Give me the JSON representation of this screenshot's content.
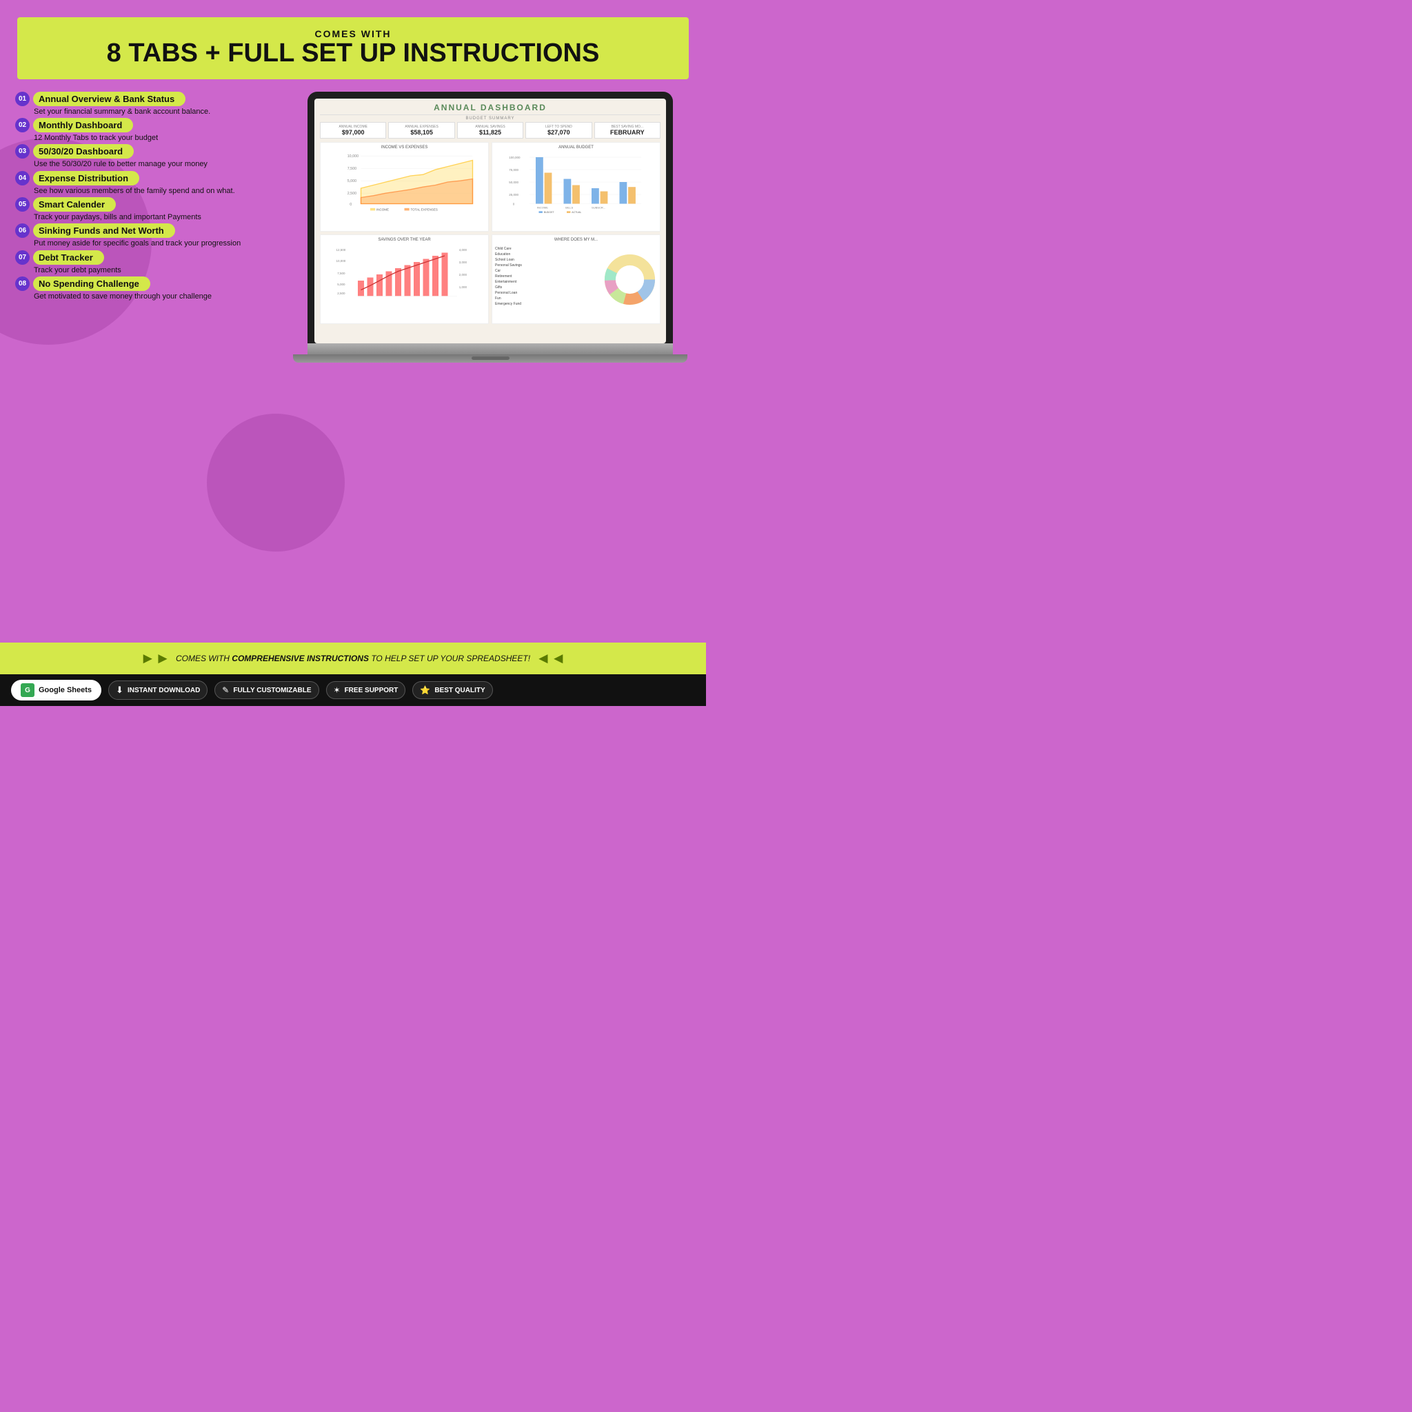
{
  "header": {
    "sub_label": "COMES WITH",
    "main_label": "8 TABS + FULL SET UP INSTRUCTIONS"
  },
  "features": [
    {
      "number": "01",
      "title": "Annual Overview & Bank Status",
      "label_text": "Annual Overview & Bank Status",
      "description": "Set your financial summary & bank account balance."
    },
    {
      "number": "02",
      "title": "Monthly Dashboard",
      "label_text": "Monthly Dashboard",
      "description": "12 Monthly Tabs to track your budget"
    },
    {
      "number": "03",
      "title": "50/30/20 Dashboard",
      "label_text": "50/30/20 Dashboard",
      "description": "Use the 50/30/20 rule to better manage your money"
    },
    {
      "number": "04",
      "title": "Expense Distribution",
      "label_text": "Expense Distribution",
      "description": "See how various members of the family spend and on what."
    },
    {
      "number": "05",
      "title": "Smart Calender",
      "label_text": "Smart Calender",
      "description": "Track your paydays, bills and important Payments"
    },
    {
      "number": "06",
      "title": "Sinking Funds and Net Worth",
      "label_text": "Sinking Funds and Net Worth",
      "description": "Put money aside for specific goals and track your progression"
    },
    {
      "number": "07",
      "title": "Debt Tracker",
      "label_text": "Debt Tracker",
      "description": "Track your debt payments"
    },
    {
      "number": "08",
      "title": "No Spending Challenge",
      "label_text": "No Spending Challenge",
      "description": "Get motivated to save money through your challenge"
    }
  ],
  "dashboard": {
    "title": "ANNUAL DASHBOARD",
    "budget_summary_label": "BUDGET SUMMARY",
    "cards": [
      {
        "label": "ANNUAL INCOME",
        "value": "$97,000"
      },
      {
        "label": "ANNUAL EXPENSES",
        "value": "$58,105"
      },
      {
        "label": "ANNUAL SAVINGS",
        "value": "$11,825"
      },
      {
        "label": "LEFT TO SPEND",
        "value": "$27,070"
      },
      {
        "label": "BEST SAVING MO...",
        "value": "FEBRUARY"
      }
    ],
    "charts": [
      {
        "title": "INCOME vs EXPENSES"
      },
      {
        "title": "ANNUAL BUDGET"
      },
      {
        "title": "SAVINGS OVER THE YEAR"
      },
      {
        "title": "WHERE DOES MY M..."
      }
    ]
  },
  "footer": {
    "text_plain": "COMES WITH ",
    "text_bold": "COMPREHENSIVE INSTRUCTIONS",
    "text_after": " TO HELP SET UP YOUR SPREADSHEET!"
  },
  "bottom_bar": {
    "badges": [
      {
        "type": "google",
        "label": "Google Sheets"
      },
      {
        "type": "dark",
        "icon": "download",
        "label": "INSTANT DOWNLOAD"
      },
      {
        "type": "dark",
        "icon": "edit",
        "label": "FULLY CUSTOMIZABLE"
      },
      {
        "type": "dark",
        "icon": "support",
        "label": "FREE SUPPORT"
      },
      {
        "type": "dark",
        "icon": "star",
        "label": "BEST QUALITY"
      }
    ]
  }
}
